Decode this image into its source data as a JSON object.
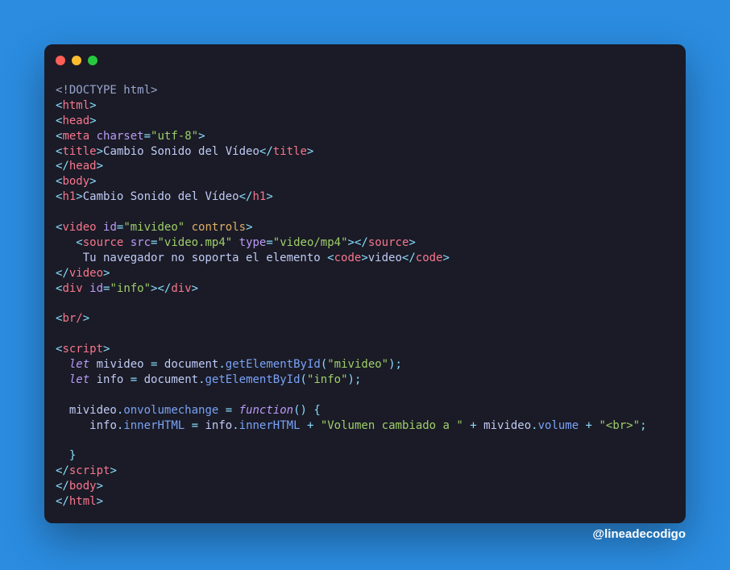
{
  "window": {
    "traffic_lights": [
      "close",
      "minimize",
      "zoom"
    ]
  },
  "code": {
    "doctype": "<!DOCTYPE html>",
    "html_open": "html",
    "head_open": "head",
    "meta_tag": "meta",
    "meta_attr": "charset",
    "meta_val": "\"utf-8\"",
    "title_tag": "title",
    "title_text": "Cambio Sonido del Vídeo",
    "head_close": "head",
    "body_open": "body",
    "h1_tag": "h1",
    "h1_text": "Cambio Sonido del Vídeo",
    "video_tag": "video",
    "video_id_attr": "id",
    "video_id_val": "\"mivideo\"",
    "video_controls": "controls",
    "source_tag": "source",
    "source_src_attr": "src",
    "source_src_val": "\"video.mp4\"",
    "source_type_attr": "type",
    "source_type_val": "\"video/mp4\"",
    "fallback_text_pre": "    Tu navegador no soporta el elemento ",
    "code_tag": "code",
    "code_text": "video",
    "div_tag": "div",
    "div_id_attr": "id",
    "div_id_val": "\"info\"",
    "br_tag": "br/",
    "script_tag": "script",
    "let1": "let",
    "var_mivideo": "mivideo",
    "var_document": "document",
    "fn_getById": "getElementById",
    "arg_mivideo": "\"mivideo\"",
    "let2": "let",
    "var_info": "info",
    "arg_info": "\"info\"",
    "prop_onvolchange": "onvolumechange",
    "kw_function": "function",
    "prop_innerHTML": "innerHTML",
    "str_volumen": "\"Volumen cambiado a \"",
    "prop_volume": "volume",
    "str_br": "\"<br>\"",
    "body_close": "body",
    "html_close": "html"
  },
  "watermark": "@lineadecodigo"
}
